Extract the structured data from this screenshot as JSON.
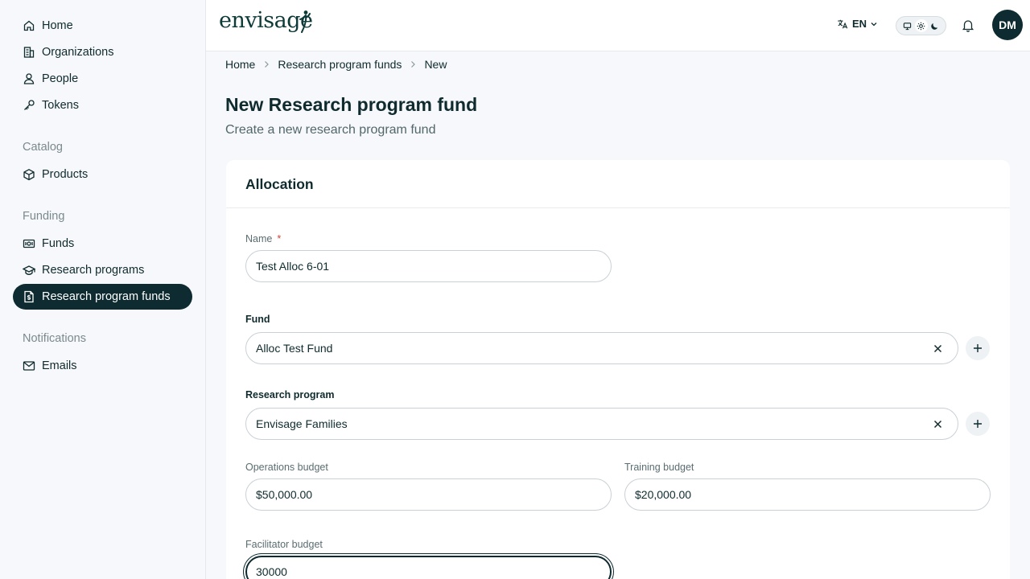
{
  "sidebar": {
    "items": [
      {
        "label": "Home",
        "icon": "home-icon"
      },
      {
        "label": "Organizations",
        "icon": "building-icon"
      },
      {
        "label": "People",
        "icon": "person-icon"
      },
      {
        "label": "Tokens",
        "icon": "key-icon"
      }
    ],
    "catalog_title": "Catalog",
    "catalog_items": [
      {
        "label": "Products",
        "icon": "box-icon"
      }
    ],
    "funding_title": "Funding",
    "funding_items": [
      {
        "label": "Funds",
        "icon": "banknote-icon"
      },
      {
        "label": "Research programs",
        "icon": "graduation-cap-icon"
      },
      {
        "label": "Research program funds",
        "icon": "file-dollar-icon",
        "active": true
      }
    ],
    "notifications_title": "Notifications",
    "notifications_items": [
      {
        "label": "Emails",
        "icon": "mail-icon"
      }
    ]
  },
  "header": {
    "logo_text": "envisage",
    "language": "EN"
  },
  "avatar_initials": "DM",
  "breadcrumb": [
    "Home",
    "Research program funds",
    "New"
  ],
  "page": {
    "title": "New Research program fund",
    "subtitle": "Create a new research program fund"
  },
  "card": {
    "title": "Allocation"
  },
  "form": {
    "name_label": "Name",
    "required_mark": "*",
    "name_value": "Test Alloc 6-01",
    "fund_label": "Fund",
    "fund_value": "Alloc Test Fund",
    "research_program_label": "Research program",
    "research_program_value": "Envisage Families",
    "operations_budget_label": "Operations budget",
    "operations_budget_value": "$50,000.00",
    "training_budget_label": "Training budget",
    "training_budget_value": "$20,000.00",
    "facilitator_budget_label": "Facilitator budget",
    "facilitator_budget_value": "30000"
  },
  "colors": {
    "primary": "#0d2b30",
    "background": "#f6f8fb",
    "required": "#d23c3c"
  }
}
